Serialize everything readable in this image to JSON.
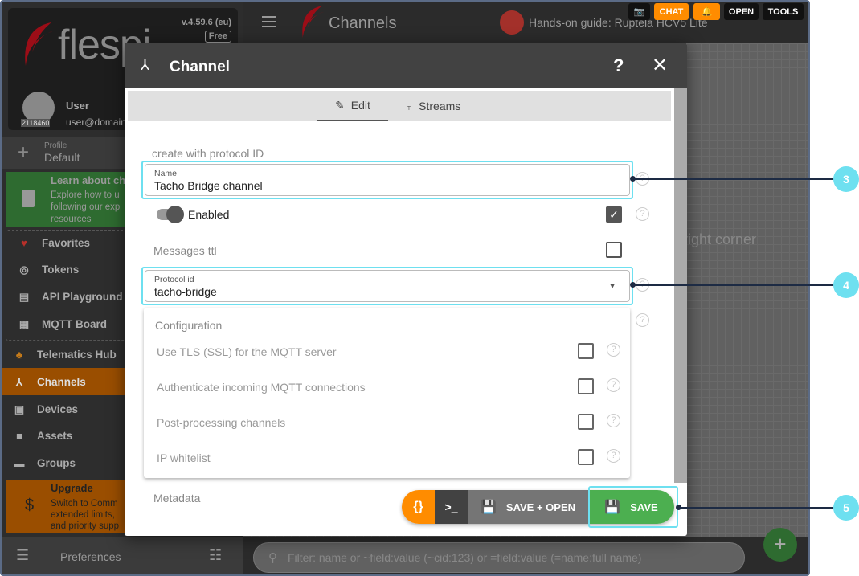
{
  "app": {
    "version": "v.4.59.6 (eu)",
    "plan": "Free",
    "logo": "flespi"
  },
  "user": {
    "name": "User",
    "email": "user@domain",
    "id": "2118460"
  },
  "profile": {
    "label": "Profile",
    "value": "Default"
  },
  "learn": {
    "title": "Learn about ch",
    "desc": "Explore how to u following our exp resources"
  },
  "sidebar": {
    "favorites": [
      {
        "label": "Favorites",
        "icon": "heart-icon"
      },
      {
        "label": "Tokens",
        "icon": "fingerprint-icon"
      },
      {
        "label": "API Playground",
        "icon": "book-icon"
      },
      {
        "label": "MQTT Board",
        "icon": "board-icon"
      }
    ],
    "items": [
      {
        "label": "Telematics Hub",
        "icon": "hub-icon"
      },
      {
        "label": "Channels",
        "icon": "channel-icon"
      },
      {
        "label": "Devices",
        "icon": "device-icon"
      },
      {
        "label": "Assets",
        "icon": "asset-icon"
      },
      {
        "label": "Groups",
        "icon": "folder-icon"
      }
    ],
    "upgrade": {
      "title": "Upgrade",
      "desc": "Switch to Comm extended limits, and priority supp"
    },
    "preferences": "Preferences"
  },
  "topbar": {
    "title": "Channels",
    "guide": "Hands-on guide: Ruptela HCV5 Lite",
    "buttons": {
      "chat": "CHAT",
      "open": "OPEN",
      "tools": "TOOLS"
    }
  },
  "main": {
    "hint": "right corner",
    "filter_placeholder": "Filter: name or ~field:value (~cid:123) or =field:value (=name:full name)"
  },
  "modal": {
    "title": "Channel",
    "help": "?",
    "close": "✕",
    "tabs": [
      {
        "label": "Edit"
      },
      {
        "label": "Streams"
      }
    ],
    "create_with": "create with protocol ID",
    "name_label": "Name",
    "name_value": "Tacho Bridge channel",
    "enabled_label": "Enabled",
    "enabled": true,
    "messages_ttl": "Messages ttl",
    "protocol_label": "Protocol id",
    "protocol_value": "tacho-bridge",
    "configuration": "Configuration",
    "config_items": [
      "Use TLS (SSL) for the MQTT server",
      "Authenticate incoming MQTT connections",
      "Post-processing channels",
      "IP whitelist"
    ],
    "metadata": "Metadata",
    "actions": {
      "json": "{}",
      "terminal": ">_",
      "save_open": "SAVE + OPEN",
      "save": "SAVE"
    }
  },
  "callouts": [
    "3",
    "4",
    "5"
  ],
  "colors": {
    "accent": "#ff8c00",
    "save": "#4caf50",
    "highlight": "#6ee0f0",
    "active_nav": "#9a4e00"
  }
}
